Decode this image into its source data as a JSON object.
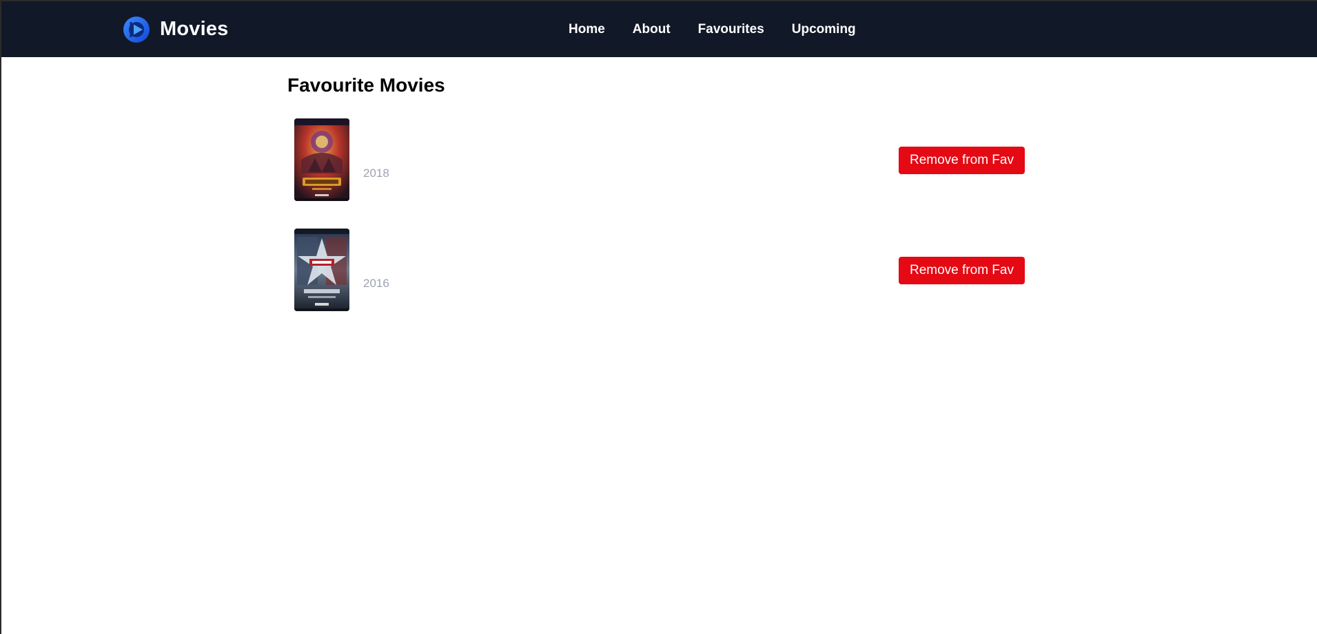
{
  "navbar": {
    "brand": "Movies",
    "logo_icon": "play-logo-icon",
    "links": [
      {
        "label": "Home"
      },
      {
        "label": "About"
      },
      {
        "label": "Favourites"
      },
      {
        "label": "Upcoming"
      }
    ]
  },
  "main": {
    "title": "Favourite Movies",
    "movies": [
      {
        "year": "2018",
        "remove_label": "Remove from Fav",
        "poster": "avengers-infinity-war-poster"
      },
      {
        "year": "2016",
        "remove_label": "Remove from Fav",
        "poster": "captain-america-civil-war-poster"
      }
    ]
  },
  "colors": {
    "navbar_bg": "#111827",
    "remove_button": "#e50914",
    "year_text": "#9ca3af",
    "logo_blue": "#1d6cf0"
  }
}
